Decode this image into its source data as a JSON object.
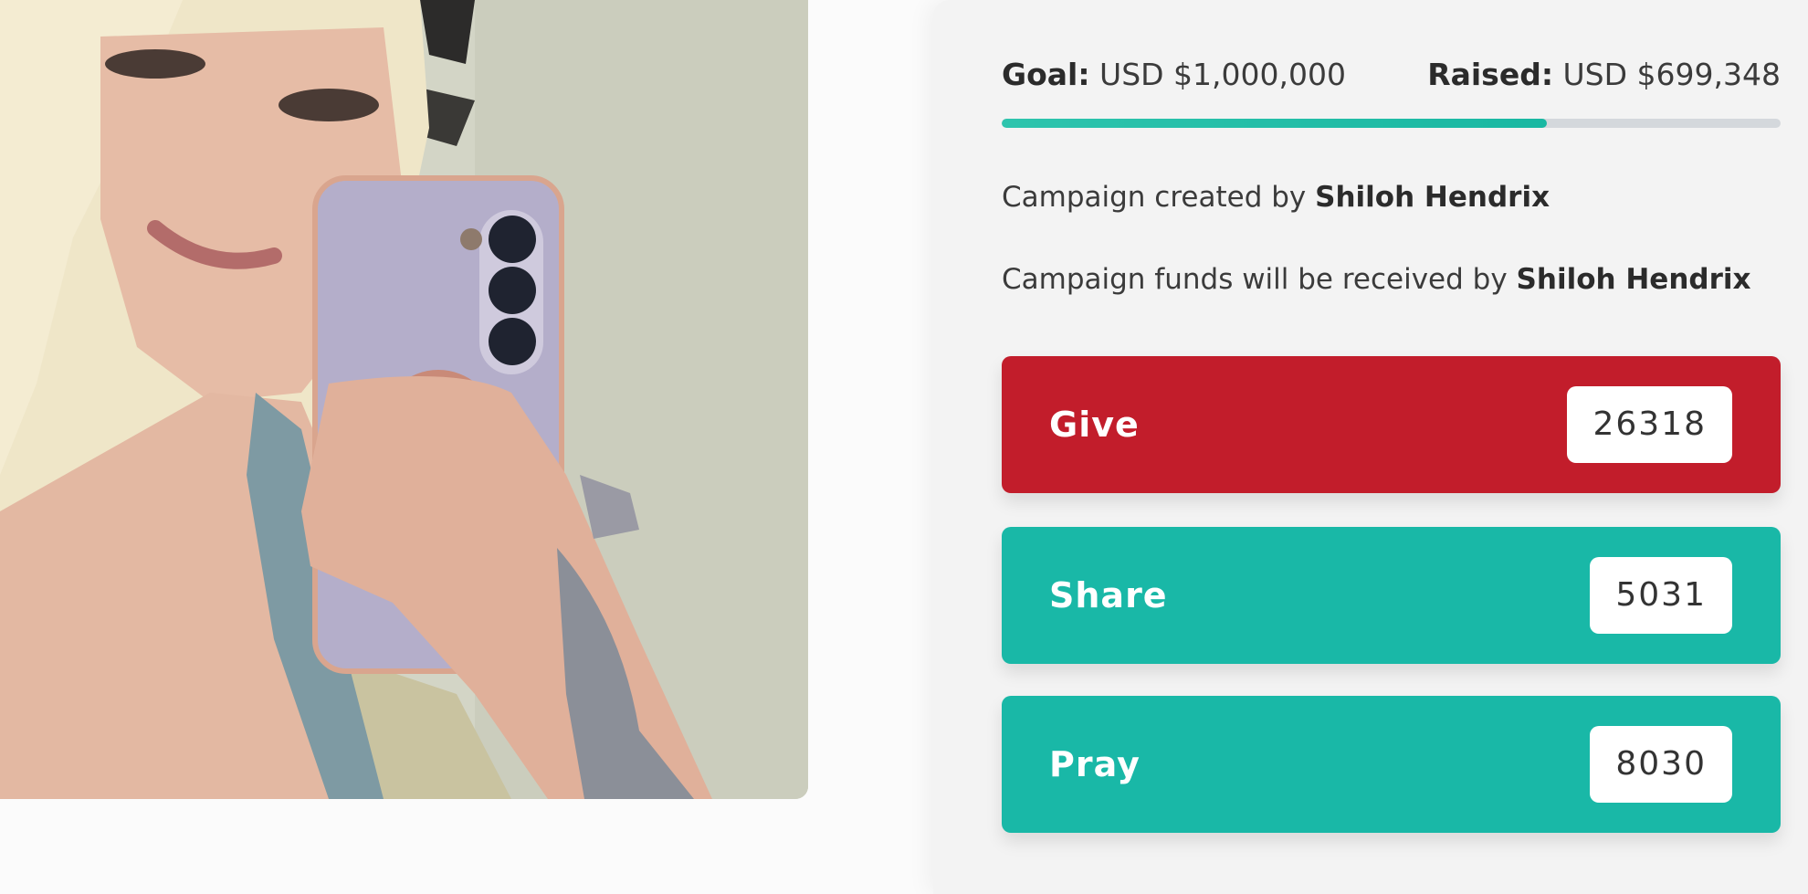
{
  "campaign": {
    "goal_label": "Goal:",
    "goal_value": "USD $1,000,000",
    "raised_label": "Raised:",
    "raised_value": "USD $699,348",
    "progress_fraction": 0.699348,
    "creator_prefix": "Campaign created by",
    "creator_name": "Shiloh Hendrix",
    "receiver_prefix": "Campaign funds will be received by",
    "receiver_name": "Shiloh Hendrix"
  },
  "actions": [
    {
      "label": "Give",
      "count": "26318",
      "color": "#c21d2b"
    },
    {
      "label": "Share",
      "count": "5031",
      "color": "#19b8a7"
    },
    {
      "label": "Pray",
      "count": "8030",
      "color": "#19b8a7"
    }
  ],
  "colors": {
    "accent_teal": "#19b8a7",
    "accent_red": "#c21d2b",
    "progress_track": "#d4d8dc"
  }
}
